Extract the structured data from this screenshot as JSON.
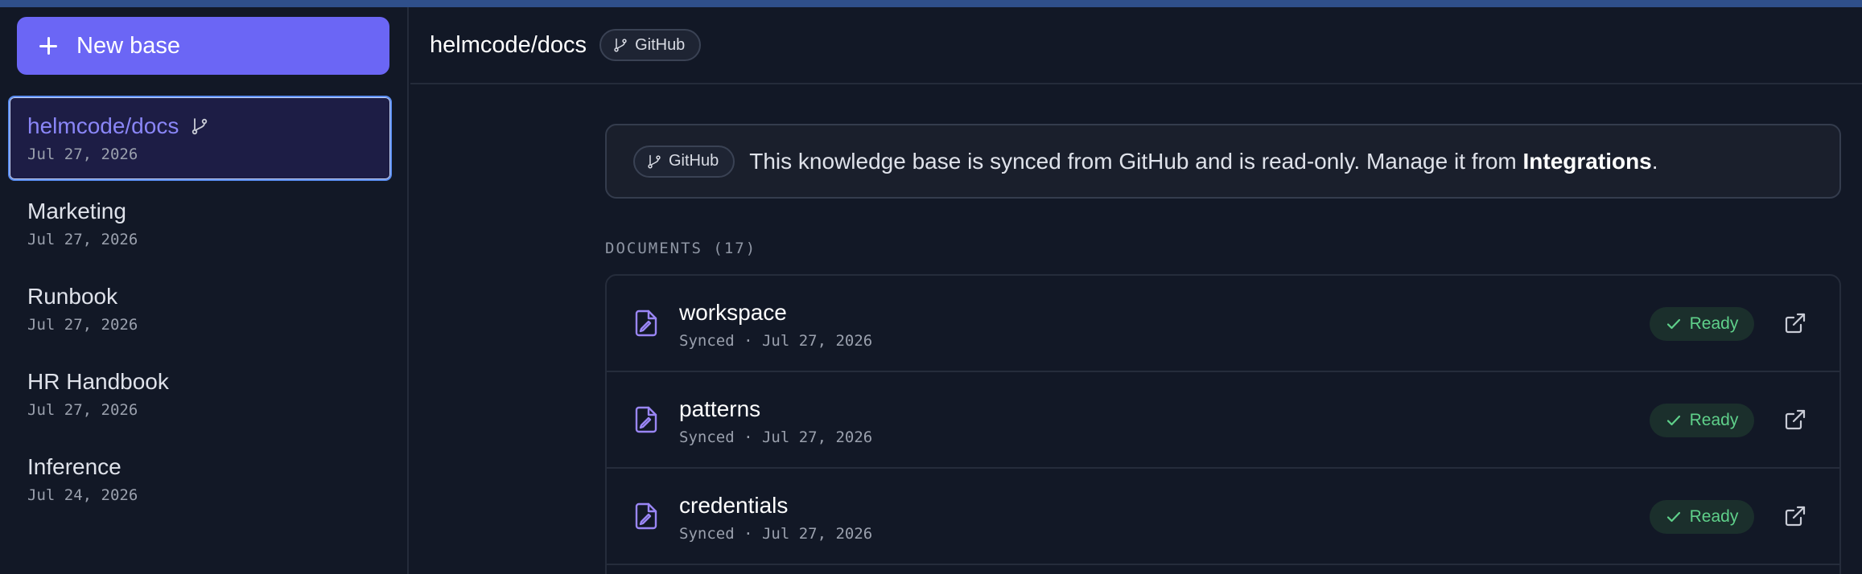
{
  "sidebar": {
    "new_base_label": "New base",
    "bases": [
      {
        "name": "helmcode/docs",
        "date": "Jul 27, 2026",
        "active": true,
        "icon": "branch-icon"
      },
      {
        "name": "Marketing",
        "date": "Jul 27, 2026"
      },
      {
        "name": "Runbook",
        "date": "Jul 27, 2026"
      },
      {
        "name": "HR Handbook",
        "date": "Jul 27, 2026"
      },
      {
        "name": "Inference",
        "date": "Jul 24, 2026"
      }
    ]
  },
  "header": {
    "title": "helmcode/docs",
    "source_badge": "GitHub"
  },
  "banner": {
    "badge": "GitHub",
    "message": "This knowledge base is synced from GitHub and is read-only. Manage it from ",
    "link_text": "Integrations",
    "suffix": "."
  },
  "documents": {
    "heading": "DOCUMENTS (17)",
    "rows": [
      {
        "name": "workspace",
        "meta": "Synced · Jul 27, 2026",
        "status": "Ready"
      },
      {
        "name": "patterns",
        "meta": "Synced · Jul 27, 2026",
        "status": "Ready"
      },
      {
        "name": "credentials",
        "meta": "Synced · Jul 27, 2026",
        "status": "Ready"
      }
    ]
  },
  "colors": {
    "accent": "#6b66f5",
    "active_text": "#8a86f7",
    "ready_green": "#5fd08a",
    "background": "#121826"
  }
}
